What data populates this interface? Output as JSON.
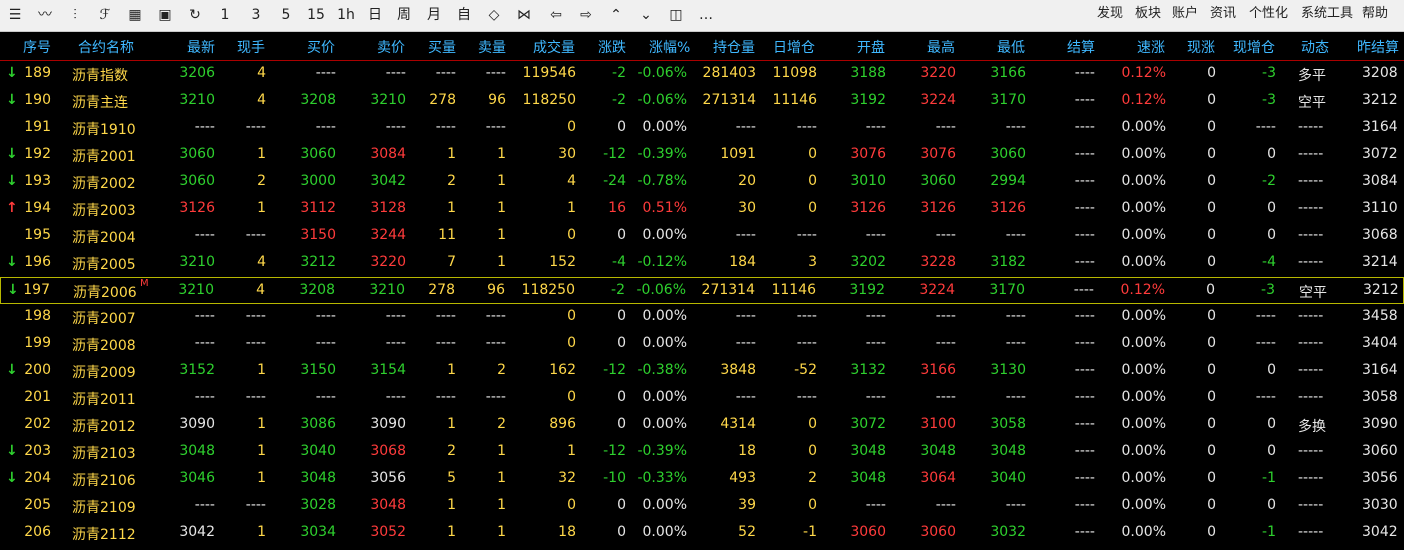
{
  "toolbar": {
    "tools": [
      {
        "name": "list-icon",
        "glyph": "☰"
      },
      {
        "name": "line-chart-icon",
        "glyph": "〰"
      },
      {
        "name": "candlestick-icon",
        "glyph": "⫶"
      },
      {
        "name": "formula-icon",
        "glyph": "ℱ"
      },
      {
        "name": "board-icon",
        "glyph": "▦"
      },
      {
        "name": "save-icon",
        "glyph": "▣"
      },
      {
        "name": "refresh-icon",
        "glyph": "↻"
      }
    ],
    "periods": [
      "1",
      "3",
      "5",
      "15",
      "1h",
      "日",
      "周",
      "月",
      "自"
    ],
    "nav_icons": [
      {
        "name": "zoom-in-icon",
        "glyph": "◇"
      },
      {
        "name": "zoom-out-icon",
        "glyph": "⋈"
      },
      {
        "name": "left-icon",
        "glyph": "⇦"
      },
      {
        "name": "right-icon",
        "glyph": "⇨"
      },
      {
        "name": "up-icon",
        "glyph": "⌃"
      },
      {
        "name": "down-icon",
        "glyph": "⌄"
      },
      {
        "name": "layout-icon",
        "glyph": "◫"
      },
      {
        "name": "more-icon",
        "glyph": "…"
      }
    ],
    "menu": [
      "发现",
      "板块",
      "账户",
      "资讯",
      "个性化",
      "系统工具",
      "帮助"
    ]
  },
  "colors": {
    "up": "#ff3b3b",
    "down": "#2ed02e",
    "header": "#3fb8ff",
    "volume": "#ffd84a",
    "selected_border": "#b8b800"
  },
  "columns": [
    "序号",
    "合约名称",
    "最新",
    "现手",
    "买价",
    "卖价",
    "买量",
    "卖量",
    "成交量",
    "涨跌",
    "涨幅%",
    "持仓量",
    "日增仓",
    "开盘",
    "最高",
    "最低",
    "结算",
    "速涨",
    "现涨",
    "现增仓",
    "动态",
    "昨结算"
  ],
  "rows": [
    {
      "arrow": "down",
      "cells": [
        "189",
        "沥青指数",
        "3206",
        "4",
        "----",
        "----",
        "----",
        "----",
        "119546",
        "-2",
        "-0.06%",
        "281403",
        "11098",
        "3188",
        "3220",
        "3166",
        "----",
        "0.12%",
        "0",
        "-3",
        "多平",
        "3208"
      ]
    },
    {
      "arrow": "down",
      "cells": [
        "190",
        "沥青主连",
        "3210",
        "4",
        "3208",
        "3210",
        "278",
        "96",
        "118250",
        "-2",
        "-0.06%",
        "271314",
        "11146",
        "3192",
        "3224",
        "3170",
        "----",
        "0.12%",
        "0",
        "-3",
        "空平",
        "3212"
      ]
    },
    {
      "arrow": "",
      "cells": [
        "191",
        "沥青1910",
        "----",
        "----",
        "----",
        "----",
        "----",
        "----",
        "0",
        "0",
        "0.00%",
        "----",
        "----",
        "----",
        "----",
        "----",
        "----",
        "0.00%",
        "0",
        "----",
        "-----",
        "3164"
      ]
    },
    {
      "arrow": "down",
      "cells": [
        "192",
        "沥青2001",
        "3060",
        "1",
        "3060",
        "3084",
        "1",
        "1",
        "30",
        "-12",
        "-0.39%",
        "1091",
        "0",
        "3076",
        "3076",
        "3060",
        "----",
        "0.00%",
        "0",
        "0",
        "-----",
        "3072"
      ]
    },
    {
      "arrow": "down",
      "cells": [
        "193",
        "沥青2002",
        "3060",
        "2",
        "3000",
        "3042",
        "2",
        "1",
        "4",
        "-24",
        "-0.78%",
        "20",
        "0",
        "3010",
        "3060",
        "2994",
        "----",
        "0.00%",
        "0",
        "-2",
        "-----",
        "3084"
      ]
    },
    {
      "arrow": "up",
      "cells": [
        "194",
        "沥青2003",
        "3126",
        "1",
        "3112",
        "3128",
        "1",
        "1",
        "1",
        "16",
        "0.51%",
        "30",
        "0",
        "3126",
        "3126",
        "3126",
        "----",
        "0.00%",
        "0",
        "0",
        "-----",
        "3110"
      ]
    },
    {
      "arrow": "",
      "cells": [
        "195",
        "沥青2004",
        "----",
        "----",
        "3150",
        "3244",
        "11",
        "1",
        "0",
        "0",
        "0.00%",
        "----",
        "----",
        "----",
        "----",
        "----",
        "----",
        "0.00%",
        "0",
        "0",
        "-----",
        "3068"
      ]
    },
    {
      "arrow": "down",
      "cells": [
        "196",
        "沥青2005",
        "3210",
        "4",
        "3212",
        "3220",
        "7",
        "1",
        "152",
        "-4",
        "-0.12%",
        "184",
        "3",
        "3202",
        "3228",
        "3182",
        "----",
        "0.00%",
        "0",
        "-4",
        "-----",
        "3214"
      ]
    },
    {
      "arrow": "down",
      "sel": true,
      "mark": "M",
      "cells": [
        "197",
        "沥青2006",
        "3210",
        "4",
        "3208",
        "3210",
        "278",
        "96",
        "118250",
        "-2",
        "-0.06%",
        "271314",
        "11146",
        "3192",
        "3224",
        "3170",
        "----",
        "0.12%",
        "0",
        "-3",
        "空平",
        "3212"
      ]
    },
    {
      "arrow": "",
      "cells": [
        "198",
        "沥青2007",
        "----",
        "----",
        "----",
        "----",
        "----",
        "----",
        "0",
        "0",
        "0.00%",
        "----",
        "----",
        "----",
        "----",
        "----",
        "----",
        "0.00%",
        "0",
        "----",
        "-----",
        "3458"
      ]
    },
    {
      "arrow": "",
      "cells": [
        "199",
        "沥青2008",
        "----",
        "----",
        "----",
        "----",
        "----",
        "----",
        "0",
        "0",
        "0.00%",
        "----",
        "----",
        "----",
        "----",
        "----",
        "----",
        "0.00%",
        "0",
        "----",
        "-----",
        "3404"
      ]
    },
    {
      "arrow": "down",
      "cells": [
        "200",
        "沥青2009",
        "3152",
        "1",
        "3150",
        "3154",
        "1",
        "2",
        "162",
        "-12",
        "-0.38%",
        "3848",
        "-52",
        "3132",
        "3166",
        "3130",
        "----",
        "0.00%",
        "0",
        "0",
        "-----",
        "3164"
      ]
    },
    {
      "arrow": "",
      "cells": [
        "201",
        "沥青2011",
        "----",
        "----",
        "----",
        "----",
        "----",
        "----",
        "0",
        "0",
        "0.00%",
        "----",
        "----",
        "----",
        "----",
        "----",
        "----",
        "0.00%",
        "0",
        "----",
        "-----",
        "3058"
      ]
    },
    {
      "arrow": "",
      "cells": [
        "202",
        "沥青2012",
        "3090",
        "1",
        "3086",
        "3090",
        "1",
        "2",
        "896",
        "0",
        "0.00%",
        "4314",
        "0",
        "3072",
        "3100",
        "3058",
        "----",
        "0.00%",
        "0",
        "0",
        "多换",
        "3090"
      ]
    },
    {
      "arrow": "down",
      "cells": [
        "203",
        "沥青2103",
        "3048",
        "1",
        "3040",
        "3068",
        "2",
        "1",
        "1",
        "-12",
        "-0.39%",
        "18",
        "0",
        "3048",
        "3048",
        "3048",
        "----",
        "0.00%",
        "0",
        "0",
        "-----",
        "3060"
      ]
    },
    {
      "arrow": "down",
      "cells": [
        "204",
        "沥青2106",
        "3046",
        "1",
        "3048",
        "3056",
        "5",
        "1",
        "32",
        "-10",
        "-0.33%",
        "493",
        "2",
        "3048",
        "3064",
        "3040",
        "----",
        "0.00%",
        "0",
        "-1",
        "-----",
        "3056"
      ]
    },
    {
      "arrow": "",
      "cells": [
        "205",
        "沥青2109",
        "----",
        "----",
        "3028",
        "3048",
        "1",
        "1",
        "0",
        "0",
        "0.00%",
        "39",
        "0",
        "----",
        "----",
        "----",
        "----",
        "0.00%",
        "0",
        "0",
        "-----",
        "3030"
      ]
    },
    {
      "arrow": "",
      "cells": [
        "206",
        "沥青2112",
        "3042",
        "1",
        "3034",
        "3052",
        "1",
        "1",
        "18",
        "0",
        "0.00%",
        "52",
        "-1",
        "3060",
        "3060",
        "3032",
        "----",
        "0.00%",
        "0",
        "-1",
        "-----",
        "3042"
      ]
    }
  ]
}
